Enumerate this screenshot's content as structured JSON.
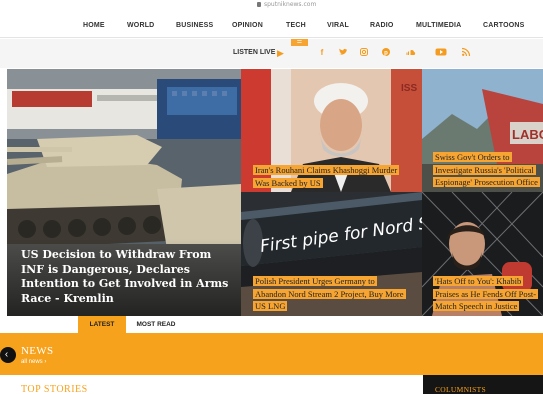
{
  "browser": {
    "url": "sputniknews.com"
  },
  "nav": {
    "items": [
      "HOME",
      "WORLD",
      "BUSINESS",
      "OPINION",
      "TECH",
      "VIRAL",
      "RADIO",
      "MULTIMEDIA",
      "CARTOONS"
    ]
  },
  "subbar": {
    "toggle_glyph": "☰",
    "listen_live": "LISTEN LIVE",
    "play_glyph": "▶",
    "social_icons": [
      "facebook-icon",
      "twitter-icon",
      "instagram-icon",
      "pinterest-icon",
      "soundcloud-icon",
      "youtube-icon",
      "rss-icon"
    ]
  },
  "stories": {
    "main": "US Decision to Withdraw From INF is Dangerous, Declares Intention to Get Involved in Arms Race - Kremlin",
    "rouhani": "Iran's Rouhani Claims Khashoggi Murder Was Backed by US",
    "swiss": "Swiss Gov't Orders to Investigate Russia's 'Political Espionage' Prosecution Office",
    "pipeline": "Polish President Urges Germany to Abandon Nord Stream 2 Project, Buy More US LNG",
    "khabib": "'Hats Off to You': Khabib Praises as He Fends Off Post-Match Speech in Justice"
  },
  "image_text": {
    "pipe": "First pipe for Nord Stream 2",
    "sign": "LABOR",
    "logo": "ISS"
  },
  "tabs": {
    "latest": "LATEST",
    "most_read": "MOST READ"
  },
  "news": {
    "prev_glyph": "‹",
    "title": "NEWS",
    "all_news": "all news ›"
  },
  "sections": {
    "top_stories": "TOP STORIES",
    "columnists": "COLUMNISTS"
  },
  "colors": {
    "accent": "#f7a21d",
    "caption_bg": "#f7a532",
    "dark": "#151515"
  }
}
